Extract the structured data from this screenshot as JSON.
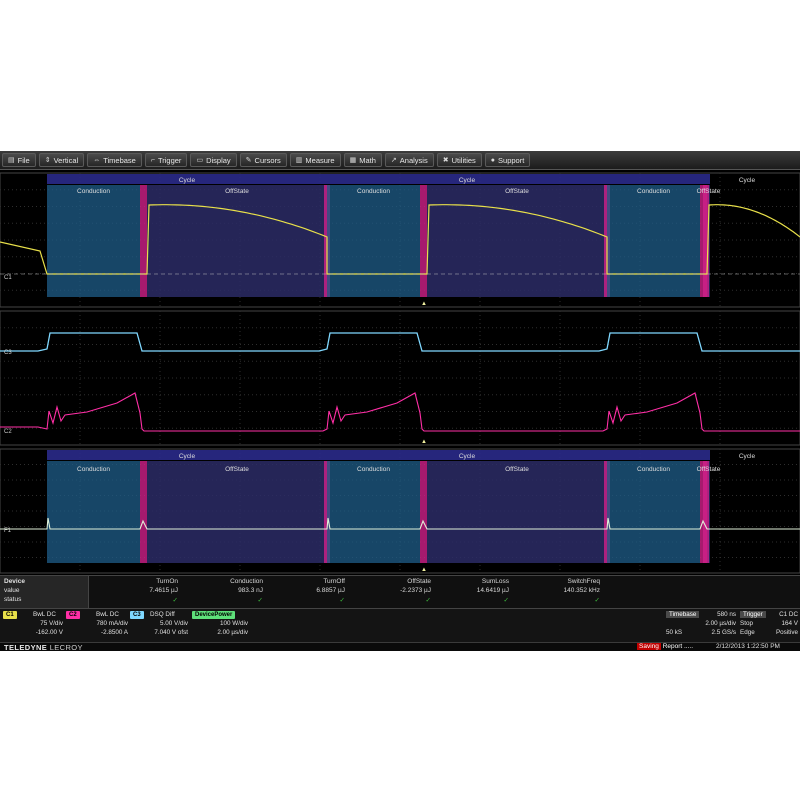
{
  "menu": [
    {
      "icon": "file-icon",
      "glyph": "▤",
      "label": "File"
    },
    {
      "icon": "vertical-icon",
      "glyph": "⇕",
      "label": "Vertical"
    },
    {
      "icon": "timebase-icon",
      "glyph": "⇔",
      "label": "Timebase"
    },
    {
      "icon": "trigger-icon",
      "glyph": "⌐",
      "label": "Trigger"
    },
    {
      "icon": "display-icon",
      "glyph": "▭",
      "label": "Display"
    },
    {
      "icon": "cursors-icon",
      "glyph": "✎",
      "label": "Cursors"
    },
    {
      "icon": "measure-icon",
      "glyph": "▥",
      "label": "Measure"
    },
    {
      "icon": "math-icon",
      "glyph": "▦",
      "label": "Math"
    },
    {
      "icon": "analysis-icon",
      "glyph": "↗",
      "label": "Analysis"
    },
    {
      "icon": "utilities-icon",
      "glyph": "✖",
      "label": "Utilities"
    },
    {
      "icon": "support-icon",
      "glyph": "●",
      "label": "Support"
    }
  ],
  "labels": {
    "cycle": "Cycle",
    "conduction": "Conduction",
    "offstate": "OffState",
    "ch1_marker": "C1",
    "ch2_marker": "C2",
    "ch3_marker": "C3",
    "f1_marker": "F1",
    "trig_marker": "▲"
  },
  "measure": {
    "device": "Device",
    "value_label": "value",
    "status_label": "status",
    "columns": [
      {
        "name": "TurnOn",
        "value": "7.4615 µJ",
        "status": "✓"
      },
      {
        "name": "Conduction",
        "value": "983.3 nJ",
        "status": "✓"
      },
      {
        "name": "TurnOff",
        "value": "6.8857 µJ",
        "status": "✓"
      },
      {
        "name": "OffState",
        "value": "-2.2373 µJ",
        "status": "✓"
      },
      {
        "name": "SumLoss",
        "value": "14.6419 µJ",
        "status": "✓"
      },
      {
        "name": "SwitchFreq",
        "value": "140.352 kHz",
        "status": "✓"
      }
    ]
  },
  "channels": {
    "c1": {
      "tag": "C1",
      "mode": "BwL DC",
      "scale": "75 V/div",
      "offset": "-162.00 V",
      "color": "#e8e04a"
    },
    "c2": {
      "tag": "C2",
      "mode": "BwL DC",
      "scale": "780 mA/div",
      "offset": "-2.8500 A",
      "color": "#ff2fa6"
    },
    "c3": {
      "tag": "C3",
      "mode": "DSQ Diff",
      "scale": "5.00 V/div",
      "offset": "7.040 V ofst",
      "color": "#7fd8ff"
    },
    "f1": {
      "tag": "DevicePower",
      "scale": "100 W/div",
      "time": "2.00 µs/div",
      "color": "#5ee07a"
    }
  },
  "timebase": {
    "label": "Timebase",
    "delay": "580 ns",
    "per_div": "2.00 µs/div",
    "samples": "50 kS",
    "rate": "2.5 GS/s"
  },
  "trigger": {
    "label": "Trigger",
    "channel": "C1 DC",
    "level": "164 V",
    "mode": "Stop",
    "type": "Edge",
    "slope": "Positive"
  },
  "status": {
    "brand": "TELEDYNE",
    "brand2": "LECROY",
    "saving": "Saving",
    "saving_rest": "Report .....",
    "datetime": "2/12/2013 1:22:50 PM"
  },
  "colors": {
    "ch1": "#e8e04a",
    "ch2_current": "#ff2fa6",
    "ch3": "#7fd8ff",
    "f1": "#5ee07a",
    "conduction": "#1f5d8a",
    "offstate": "#2c2c66",
    "cycle": "#2a2a8a",
    "transition": "#d0208a"
  }
}
